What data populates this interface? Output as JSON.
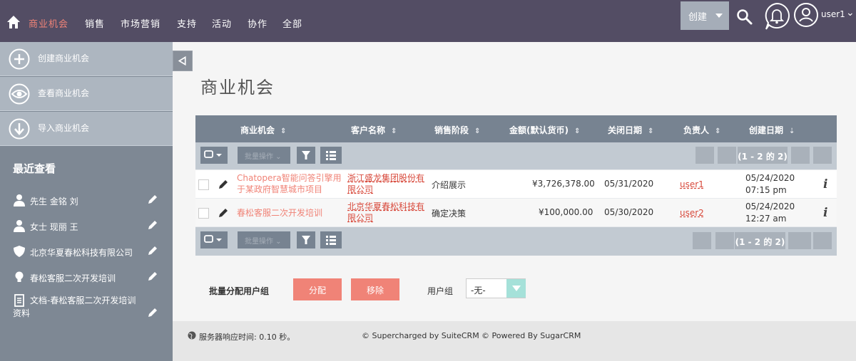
{
  "nav": {
    "items": [
      {
        "label": "商业机会",
        "active": true
      },
      {
        "label": "销售"
      },
      {
        "label": "市场营销"
      },
      {
        "label": "支持"
      },
      {
        "label": "活动"
      },
      {
        "label": "协作"
      },
      {
        "label": "全部"
      }
    ],
    "create_label": "创建",
    "username": "user1"
  },
  "sidebar": {
    "actions": [
      {
        "label": "创建商业机会",
        "icon": "plus-icon"
      },
      {
        "label": "查看商业机会",
        "icon": "eye-icon"
      },
      {
        "label": "导入商业机会",
        "icon": "download-icon"
      }
    ],
    "recent_title": "最近查看",
    "recent": [
      {
        "label": "先生 金铭 刘",
        "icon": "person-icon"
      },
      {
        "label": "女士 现丽 王",
        "icon": "person-icon"
      },
      {
        "label": "北京华夏春松科技有限公司",
        "icon": "shield-icon"
      },
      {
        "label": "春松客服二次开发培训",
        "icon": "lightbulb-icon"
      },
      {
        "label": "文档-春松客服二次开发培训",
        "label2": "资料",
        "icon": "document-icon"
      }
    ]
  },
  "page_title": "商业机会",
  "table": {
    "columns": [
      "商业机会",
      "客户名称",
      "销售阶段",
      "金额(默认货币)",
      "关闭日期",
      "负责人",
      "创建日期"
    ],
    "bulk_action": "批量操作",
    "pagination": "(1 - 2 的 2)",
    "rows": [
      {
        "name_l1": "Chatopera智能问答引擎用",
        "name_l2": "于某政府智慧城市项目",
        "account_l1": "浙江盛龙集团股份有",
        "account_l2": "限公司",
        "stage": "介绍展示",
        "amount": "¥3,726,378.00",
        "close_date": "05/31/2020",
        "owner": "user1",
        "created_date": "05/24/2020",
        "created_time": "07:15 pm"
      },
      {
        "name_l1": "春松客服二次开发培训",
        "name_l2": "",
        "account_l1": "北京华夏春松科技有",
        "account_l2": "限公司",
        "stage": "确定决策",
        "amount": "¥100,000.00",
        "close_date": "05/30/2020",
        "owner": "user2",
        "created_date": "05/24/2020",
        "created_time": "12:27 am"
      }
    ]
  },
  "bulk_assign": {
    "label": "批量分配用户组",
    "assign_label": "分配",
    "remove_label": "移除",
    "group_label": "用户组",
    "group_value": "-无-"
  },
  "footer": {
    "response_time": "服务器响应时间:  0.10 秒。",
    "suitecrm": "© Supercharged by SuiteCRM",
    "sugarcrm": "© Powered By SugarCRM"
  },
  "colors": {
    "nav_bg": "#534d64",
    "accent": "#f08377",
    "sidebar_bg": "#7e8894",
    "table_header": "#778391"
  }
}
